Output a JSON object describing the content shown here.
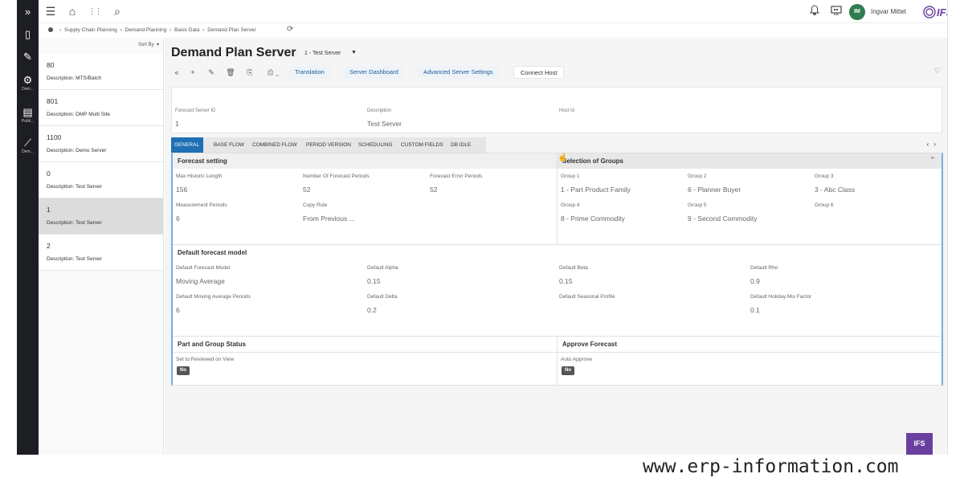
{
  "rail": {
    "expand_icon": "»",
    "items": [
      {
        "icon": "bookmark-icon",
        "glyph": "▯",
        "label": ""
      },
      {
        "icon": "pencil-icon",
        "glyph": "✎",
        "label": ""
      },
      {
        "icon": "gear-icon",
        "glyph": "⚙",
        "label": "Dem..."
      },
      {
        "icon": "publish-icon",
        "glyph": "▤",
        "label": "Publi..."
      },
      {
        "icon": "chart-icon",
        "glyph": "⟋",
        "label": "Dem..."
      }
    ]
  },
  "topbar": {
    "menu_icon": "☰",
    "home_icon": "⌂",
    "apps_icon": "⋮⋮",
    "search_icon": "⌕",
    "bell_icon": "🔔",
    "screen_icon": "▭",
    "user_initials": "IM",
    "user_name": "Ingvar Mittet",
    "logo": "IFS"
  },
  "breadcrumb": {
    "items": [
      "Supply Chain Planning",
      "Demand Planning",
      "Basic Data",
      "Demand Plan Server"
    ]
  },
  "list": {
    "sort_label": "Sort By",
    "items": [
      {
        "id": "80",
        "description": "Description:  MTS/Batch"
      },
      {
        "id": "801",
        "description": "Description:  DMP Multi Site"
      },
      {
        "id": "1100",
        "description": "Description:  Demo Server"
      },
      {
        "id": "0",
        "description": "Description:  Test Server"
      },
      {
        "id": "1",
        "description": "Description:  Test Server"
      },
      {
        "id": "2",
        "description": "Description:  Test Server"
      }
    ]
  },
  "page": {
    "title": "Demand Plan Server",
    "subtitle": "1 - Test Server"
  },
  "toolbar": {
    "translation": "Translation",
    "server_dashboard": "Server Dashboard",
    "advanced_server_settings": "Advanced Server Settings",
    "connect_host": "Connect Host"
  },
  "header": {
    "forecast_server_id_label": "Forecast Server ID",
    "forecast_server_id_value": "1",
    "description_label": "Description",
    "description_value": "Test Server",
    "host_id_label": "Host Id",
    "host_id_value": ""
  },
  "tabs": [
    "GENERAL",
    "BASE FLOW",
    "COMBINED FLOW",
    "PERIOD VERSION",
    "SCHEDULING",
    "CUSTOM FIELDS",
    "DB IDLE"
  ],
  "forecast_setting": {
    "title": "Forecast setting",
    "max_historic_length_label": "Max Historic Length",
    "max_historic_length_value": "156",
    "number_of_forecast_periods_label": "Number Of Forecast Periods",
    "number_of_forecast_periods_value": "52",
    "forecast_error_periods_label": "Forecast Error Periods",
    "forecast_error_periods_value": "52",
    "measurement_periods_label": "Measurement Periods",
    "measurement_periods_value": "6",
    "copy_rule_label": "Copy Rule",
    "copy_rule_value": "From Previous ..."
  },
  "selection_of_groups": {
    "title": "Selection of Groups",
    "groups": [
      {
        "label": "Group 1",
        "value": "1 - Part Product Family"
      },
      {
        "label": "Group 2",
        "value": "6 - Planner Buyer"
      },
      {
        "label": "Group 3",
        "value": "3 - Abc Class"
      },
      {
        "label": "Group 4",
        "value": "8 - Prime Commodity"
      },
      {
        "label": "Group 5",
        "value": "9 - Second Commodity"
      },
      {
        "label": "Group 6",
        "value": ""
      }
    ]
  },
  "default_forecast_model": {
    "title": "Default forecast model",
    "default_forecast_model_label": "Default Forecast Model",
    "default_forecast_model_value": "Moving Average",
    "default_alpha_label": "Default Alpha",
    "default_alpha_value": "0.15",
    "default_beta_label": "Default Beta",
    "default_beta_value": "0.15",
    "default_rho_label": "Default Rho",
    "default_rho_value": "0.9",
    "default_moving_average_periods_label": "Default Moving Average Periods",
    "default_moving_average_periods_value": "6",
    "default_delta_label": "Default Delta",
    "default_delta_value": "0.2",
    "default_seasonal_profile_label": "Default Seasonal Profile",
    "default_seasonal_profile_value": "",
    "default_holiday_mix_factor_label": "Default Holiday Mix Factor",
    "default_holiday_mix_factor_value": "0.1"
  },
  "part_and_group_status": {
    "title": "Part and Group Status",
    "set_to_reviewed_label": "Set to Reviewed on View",
    "set_to_reviewed_value": "No"
  },
  "approve_forecast": {
    "title": "Approve Forecast",
    "auto_approve_label": "Auto Approve",
    "auto_approve_value": "No"
  },
  "footer_badge": "IFS",
  "watermark": "www.erp-information.com",
  "colors": {
    "rail": "#1d1d24",
    "active_tab": "#1f6fb5",
    "link": "#1b5c9c",
    "avatar": "#2e7d4f",
    "brand": "#6b3fa0"
  }
}
